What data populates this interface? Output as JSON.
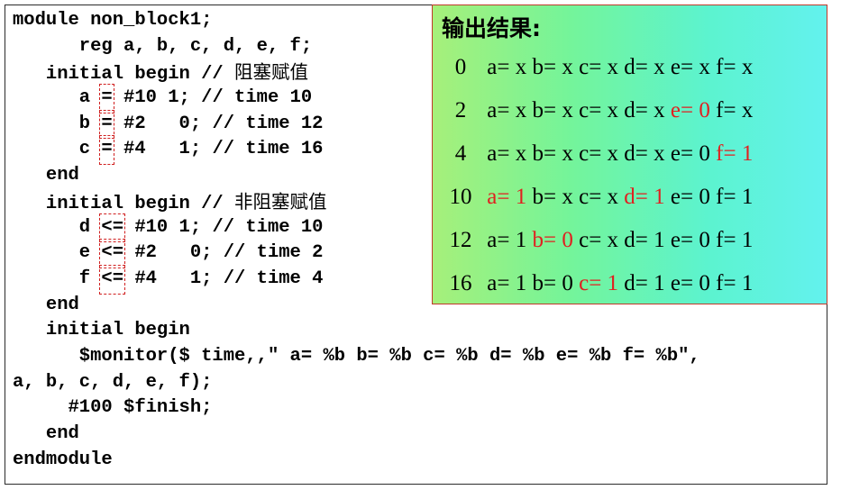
{
  "code": {
    "lines": [
      {
        "text": "module non_block1;"
      },
      {
        "text": "      reg a, b, c, d, e, f;"
      },
      {
        "text": "   initial begin // ",
        "cjk": "阻塞赋值"
      },
      {
        "pre": "      a ",
        "mark": "=",
        "post": " #10 1; // time 10"
      },
      {
        "pre": "      b ",
        "mark": "=",
        "post": " #2   0; // time 12"
      },
      {
        "pre": "      c ",
        "mark": "=",
        "post": " #4   1; // time 16"
      },
      {
        "text": "   end"
      },
      {
        "text": "   initial begin // ",
        "cjk": "非阻塞赋值"
      },
      {
        "pre": "      d ",
        "mark": "<=",
        "post": " #10 1; // time 10"
      },
      {
        "pre": "      e ",
        "mark": "<=",
        "post": " #2   0; // time 2"
      },
      {
        "pre": "      f ",
        "mark": "<=",
        "post": " #4   1; // time 4"
      },
      {
        "text": "   end"
      },
      {
        "text": "   initial begin"
      },
      {
        "text": "      $monitor($ time,,\" a= %b b= %b c= %b d= %b e= %b f= %b\","
      },
      {
        "text": "a, b, c, d, e, f);"
      },
      {
        "text": "     #100 $finish;"
      },
      {
        "text": "   end"
      },
      {
        "text": "endmodule"
      }
    ]
  },
  "output": {
    "title": "输出结果:",
    "highlight_color": "#e02020",
    "rows": [
      {
        "t": "0",
        "cells": [
          {
            "n": "a",
            "v": "x"
          },
          {
            "n": "b",
            "v": "x"
          },
          {
            "n": "c",
            "v": "x"
          },
          {
            "n": "d",
            "v": "x"
          },
          {
            "n": "e",
            "v": "x"
          },
          {
            "n": "f",
            "v": "x"
          }
        ]
      },
      {
        "t": "2",
        "cells": [
          {
            "n": "a",
            "v": "x"
          },
          {
            "n": "b",
            "v": "x"
          },
          {
            "n": "c",
            "v": "x"
          },
          {
            "n": "d",
            "v": "x"
          },
          {
            "n": "e",
            "v": "0",
            "hl": true
          },
          {
            "n": "f",
            "v": "x"
          }
        ]
      },
      {
        "t": "4",
        "cells": [
          {
            "n": "a",
            "v": "x"
          },
          {
            "n": "b",
            "v": "x"
          },
          {
            "n": "c",
            "v": "x"
          },
          {
            "n": "d",
            "v": "x"
          },
          {
            "n": "e",
            "v": "0"
          },
          {
            "n": "f",
            "v": "1",
            "hl": true
          }
        ]
      },
      {
        "t": "10",
        "cells": [
          {
            "n": "a",
            "v": "1",
            "hl": true
          },
          {
            "n": "b",
            "v": "x"
          },
          {
            "n": "c",
            "v": "x"
          },
          {
            "n": "d",
            "v": "1",
            "hl": true
          },
          {
            "n": "e",
            "v": "0"
          },
          {
            "n": "f",
            "v": "1"
          }
        ]
      },
      {
        "t": "12",
        "cells": [
          {
            "n": "a",
            "v": "1"
          },
          {
            "n": "b",
            "v": "0",
            "hl": true
          },
          {
            "n": "c",
            "v": "x"
          },
          {
            "n": "d",
            "v": "1"
          },
          {
            "n": "e",
            "v": "0"
          },
          {
            "n": "f",
            "v": "1"
          }
        ]
      },
      {
        "t": "16",
        "cells": [
          {
            "n": "a",
            "v": "1"
          },
          {
            "n": "b",
            "v": "0"
          },
          {
            "n": "c",
            "v": "1",
            "hl": true
          },
          {
            "n": "d",
            "v": "1"
          },
          {
            "n": "e",
            "v": "0"
          },
          {
            "n": "f",
            "v": "1"
          }
        ]
      }
    ]
  }
}
